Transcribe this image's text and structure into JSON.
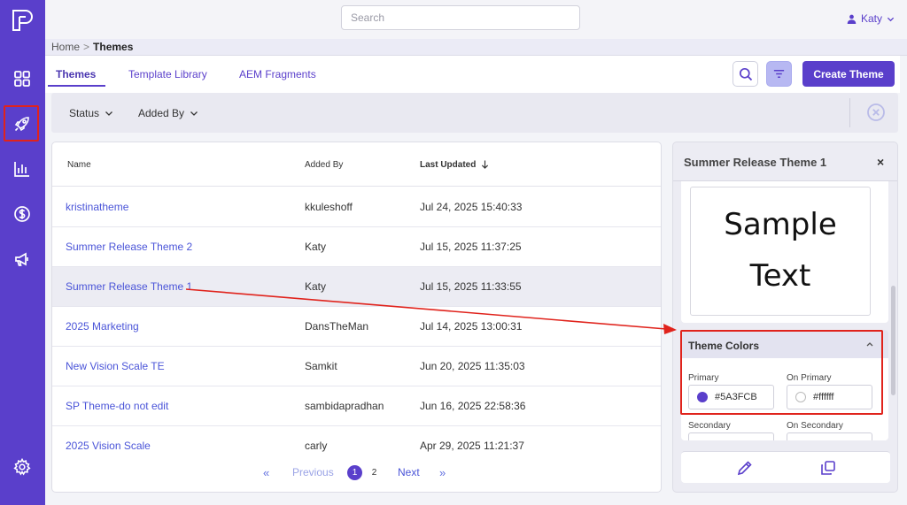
{
  "topbar": {
    "search_placeholder": "Search",
    "user_name": "Katy"
  },
  "sidebar": {
    "items": [
      {
        "icon": "dashboard-grid-icon"
      },
      {
        "icon": "rocket-icon",
        "active": true
      },
      {
        "icon": "bar-chart-icon"
      },
      {
        "icon": "dollar-icon"
      },
      {
        "icon": "megaphone-icon"
      }
    ],
    "settings_icon": "gear-icon"
  },
  "breadcrumb": {
    "home": "Home",
    "separator": ">",
    "current": "Themes"
  },
  "tabs": [
    {
      "label": "Themes",
      "active": true
    },
    {
      "label": "Template Library",
      "active": false
    },
    {
      "label": "AEM Fragments",
      "active": false
    }
  ],
  "toolbar": {
    "create_label": "Create Theme"
  },
  "filters": {
    "status_label": "Status",
    "added_by_label": "Added By"
  },
  "table": {
    "columns": {
      "name": "Name",
      "added_by": "Added By",
      "last_updated": "Last Updated"
    },
    "rows": [
      {
        "name": "kristinatheme",
        "added_by": "kkuleshoff",
        "last_updated": "Jul 24, 2025 15:40:33"
      },
      {
        "name": "Summer Release Theme 2",
        "added_by": "Katy",
        "last_updated": "Jul 15, 2025 11:37:25"
      },
      {
        "name": "Summer Release Theme 1",
        "added_by": "Katy",
        "last_updated": "Jul 15, 2025 11:33:55",
        "selected": true
      },
      {
        "name": "2025 Marketing",
        "added_by": "DansTheMan",
        "last_updated": "Jul 14, 2025 13:00:31"
      },
      {
        "name": "New Vision Scale TE",
        "added_by": "Samkit",
        "last_updated": "Jun 20, 2025 11:35:03"
      },
      {
        "name": "SP Theme-do not edit",
        "added_by": "sambidapradhan",
        "last_updated": "Jun 16, 2025 22:58:36"
      },
      {
        "name": "2025 Vision Scale",
        "added_by": "carly",
        "last_updated": "Apr 29, 2025 11:21:37"
      }
    ]
  },
  "pagination": {
    "first": "«",
    "previous": "Previous",
    "pages": [
      "1",
      "2"
    ],
    "current_page": "1",
    "next": "Next",
    "last": "»"
  },
  "panel": {
    "title": "Summer Release Theme 1",
    "close": "×",
    "sample_text": "Sample Text",
    "colors_title": "Theme Colors",
    "primary_label": "Primary",
    "primary_value": "#5A3FCB",
    "on_primary_label": "On Primary",
    "on_primary_value": "#ffffff",
    "secondary_label": "Secondary",
    "on_secondary_label": "On Secondary"
  },
  "colors": {
    "brand": "#5A3FCB",
    "highlight_red": "#E0231C"
  }
}
